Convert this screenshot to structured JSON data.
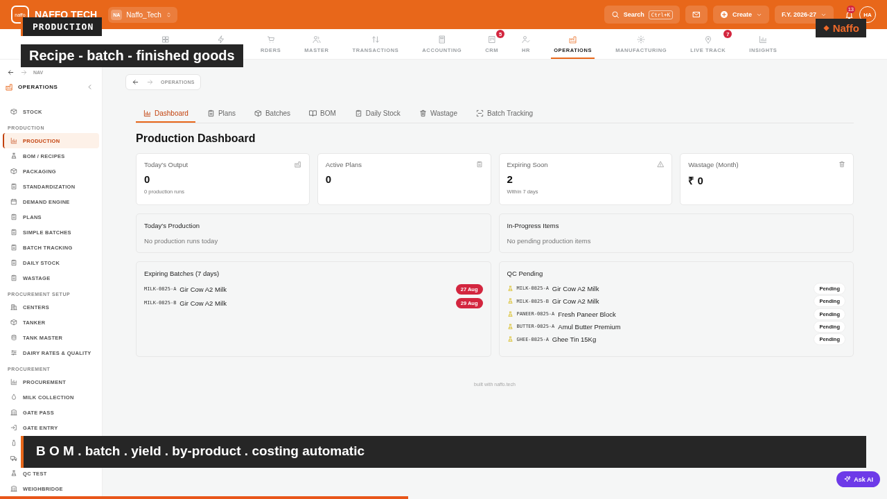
{
  "top_bar": {
    "logo_mark": "naffo",
    "brand": "NAFFO TECH",
    "org": {
      "initials": "NA",
      "name": "Naffo_Tech"
    },
    "search": {
      "label": "Search",
      "shortcut": "Ctrl+K"
    },
    "create": "Create",
    "fiscal_year": "F.Y. 2026-27",
    "notifications": "13",
    "avatar": "HA"
  },
  "modules": [
    {
      "selected": false
    },
    {
      "selected": false
    },
    {
      "label": "RDERS",
      "selected": false
    },
    {
      "label": "MASTER",
      "selected": false
    },
    {
      "label": "TRANSACTIONS",
      "selected": false
    },
    {
      "label": "ACCOUNTING",
      "selected": false
    },
    {
      "label": "CRM",
      "badge": "5",
      "selected": false
    },
    {
      "label": "HR",
      "selected": false
    },
    {
      "label": "OPERATIONS",
      "selected": true
    },
    {
      "label": "MANUFACTURING",
      "selected": false
    },
    {
      "label": "LIVE TRACK",
      "badge": "7",
      "selected": false
    },
    {
      "label": "INSIGHTS",
      "selected": false
    }
  ],
  "sidebar": {
    "nav_label": "NAV",
    "title": "OPERATIONS",
    "groups": [
      {
        "items": [
          {
            "label": "STOCK",
            "selected": false
          }
        ]
      },
      {
        "heading": "PRODUCTION",
        "items": [
          {
            "label": "PRODUCTION",
            "selected": true
          },
          {
            "label": "BOM / RECIPES",
            "selected": false
          },
          {
            "label": "PACKAGING",
            "selected": false
          },
          {
            "label": "STANDARDIZATION",
            "selected": false
          },
          {
            "label": "DEMAND ENGINE",
            "selected": false
          },
          {
            "label": "PLANS",
            "selected": false
          },
          {
            "label": "SIMPLE BATCHES",
            "selected": false
          },
          {
            "label": "BATCH TRACKING",
            "selected": false
          },
          {
            "label": "DAILY STOCK",
            "selected": false
          },
          {
            "label": "WASTAGE",
            "selected": false
          }
        ]
      },
      {
        "heading": "PROCUREMENT SETUP",
        "items": [
          {
            "label": "CENTERS",
            "selected": false
          },
          {
            "label": "TANKER",
            "selected": false
          },
          {
            "label": "TANK MASTER",
            "selected": false
          },
          {
            "label": "DAIRY RATES & QUALITY",
            "selected": false
          }
        ]
      },
      {
        "heading": "PROCUREMENT",
        "items": [
          {
            "label": "PROCUREMENT",
            "selected": false
          },
          {
            "label": "MILK COLLECTION",
            "selected": false
          },
          {
            "label": "GATE PASS",
            "selected": false
          },
          {
            "label": "GATE ENTRY",
            "selected": false
          },
          {
            "selected": false
          },
          {
            "selected": false
          },
          {
            "label": "QC TEST",
            "selected": false
          },
          {
            "label": "WEIGHBRIDGE",
            "selected": false
          }
        ]
      }
    ]
  },
  "breadcrumb": "OPERATIONS",
  "tabs": [
    {
      "label": "Dashboard",
      "selected": true
    },
    {
      "label": "Plans",
      "selected": false
    },
    {
      "label": "Batches",
      "selected": false
    },
    {
      "label": "BOM",
      "selected": false
    },
    {
      "label": "Daily Stock",
      "selected": false
    },
    {
      "label": "Wastage",
      "selected": false
    },
    {
      "label": "Batch Tracking",
      "selected": false
    }
  ],
  "title": "Production Dashboard",
  "stats": [
    {
      "label": "Today's Output",
      "value": "0",
      "note": "0 production runs"
    },
    {
      "label": "Active Plans",
      "value": "0"
    },
    {
      "label": "Expiring Soon",
      "value": "2",
      "note": "Within 7 days"
    },
    {
      "label": "Wastage (Month)",
      "value": "₹ 0"
    }
  ],
  "todays_production": {
    "title": "Today's Production",
    "empty": "No production runs today"
  },
  "in_progress": {
    "title": "In-Progress Items",
    "empty": "No pending production items"
  },
  "expiring_batches": {
    "title": "Expiring Batches (7 days)",
    "rows": [
      {
        "code": "MILK-0825-A",
        "name": "Gir Cow A2 Milk",
        "date": "27 Aug"
      },
      {
        "code": "MILK-0825-B",
        "name": "Gir Cow A2 Milk",
        "date": "29 Aug"
      }
    ]
  },
  "qc_pending": {
    "title": "QC Pending",
    "rows": [
      {
        "code": "MILK-0825-A",
        "name": "Gir Cow A2 Milk",
        "status": "Pending"
      },
      {
        "code": "MILK-0825-B",
        "name": "Gir Cow A2 Milk",
        "status": "Pending"
      },
      {
        "code": "PANEER-0825-A",
        "name": "Fresh Paneer Block",
        "status": "Pending"
      },
      {
        "code": "BUTTER-0825-A",
        "name": "Amul Butter Premium",
        "status": "Pending"
      },
      {
        "code": "GHEE-0825-A",
        "name": "Ghee Tin 15Kg",
        "status": "Pending"
      }
    ]
  },
  "footer": "built with naffo.tech",
  "overlays": {
    "tag": "PRODUCTION",
    "headline": "Recipe - batch - finished goods",
    "brand": "Naffo",
    "caption": "B O M . batch . yield . by-product . costing automatic"
  },
  "ask_ai": "Ask AI",
  "video_progress": {
    "level": 0.46
  }
}
